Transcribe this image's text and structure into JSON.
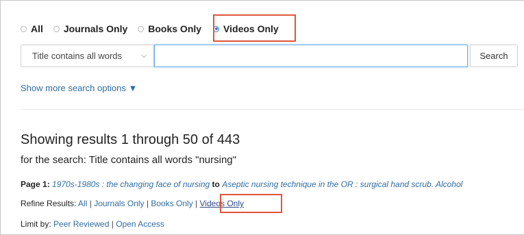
{
  "filters": {
    "options": [
      {
        "label": "All",
        "checked": false
      },
      {
        "label": "Journals Only",
        "checked": false
      },
      {
        "label": "Books Only",
        "checked": false
      },
      {
        "label": "Videos Only",
        "checked": true
      }
    ]
  },
  "search": {
    "field_select": "Title contains all words",
    "input_value": "",
    "button_label": "Search"
  },
  "more_options_label": "Show more search options ▼",
  "results": {
    "title": "Showing results 1 through 50 of 443",
    "subtitle": "for the search: Title contains all words \"nursing\"",
    "page_label": "Page 1:",
    "page_from": "1970s-1980s : the changing face of nursing",
    "page_to_word": "to",
    "page_to": "Aseptic nursing technique in the OR : surgical hand scrub. Alcohol"
  },
  "refine": {
    "label": "Refine Results:",
    "options": [
      "All",
      "Journals Only",
      "Books Only",
      "Videos Only"
    ]
  },
  "limit": {
    "label": "Limit by:",
    "options": [
      "Peer Reviewed",
      "Open Access"
    ]
  },
  "colors": {
    "highlight": "#e0553a",
    "link": "#2e6da4",
    "radio_checked": "#2d7fd0"
  }
}
